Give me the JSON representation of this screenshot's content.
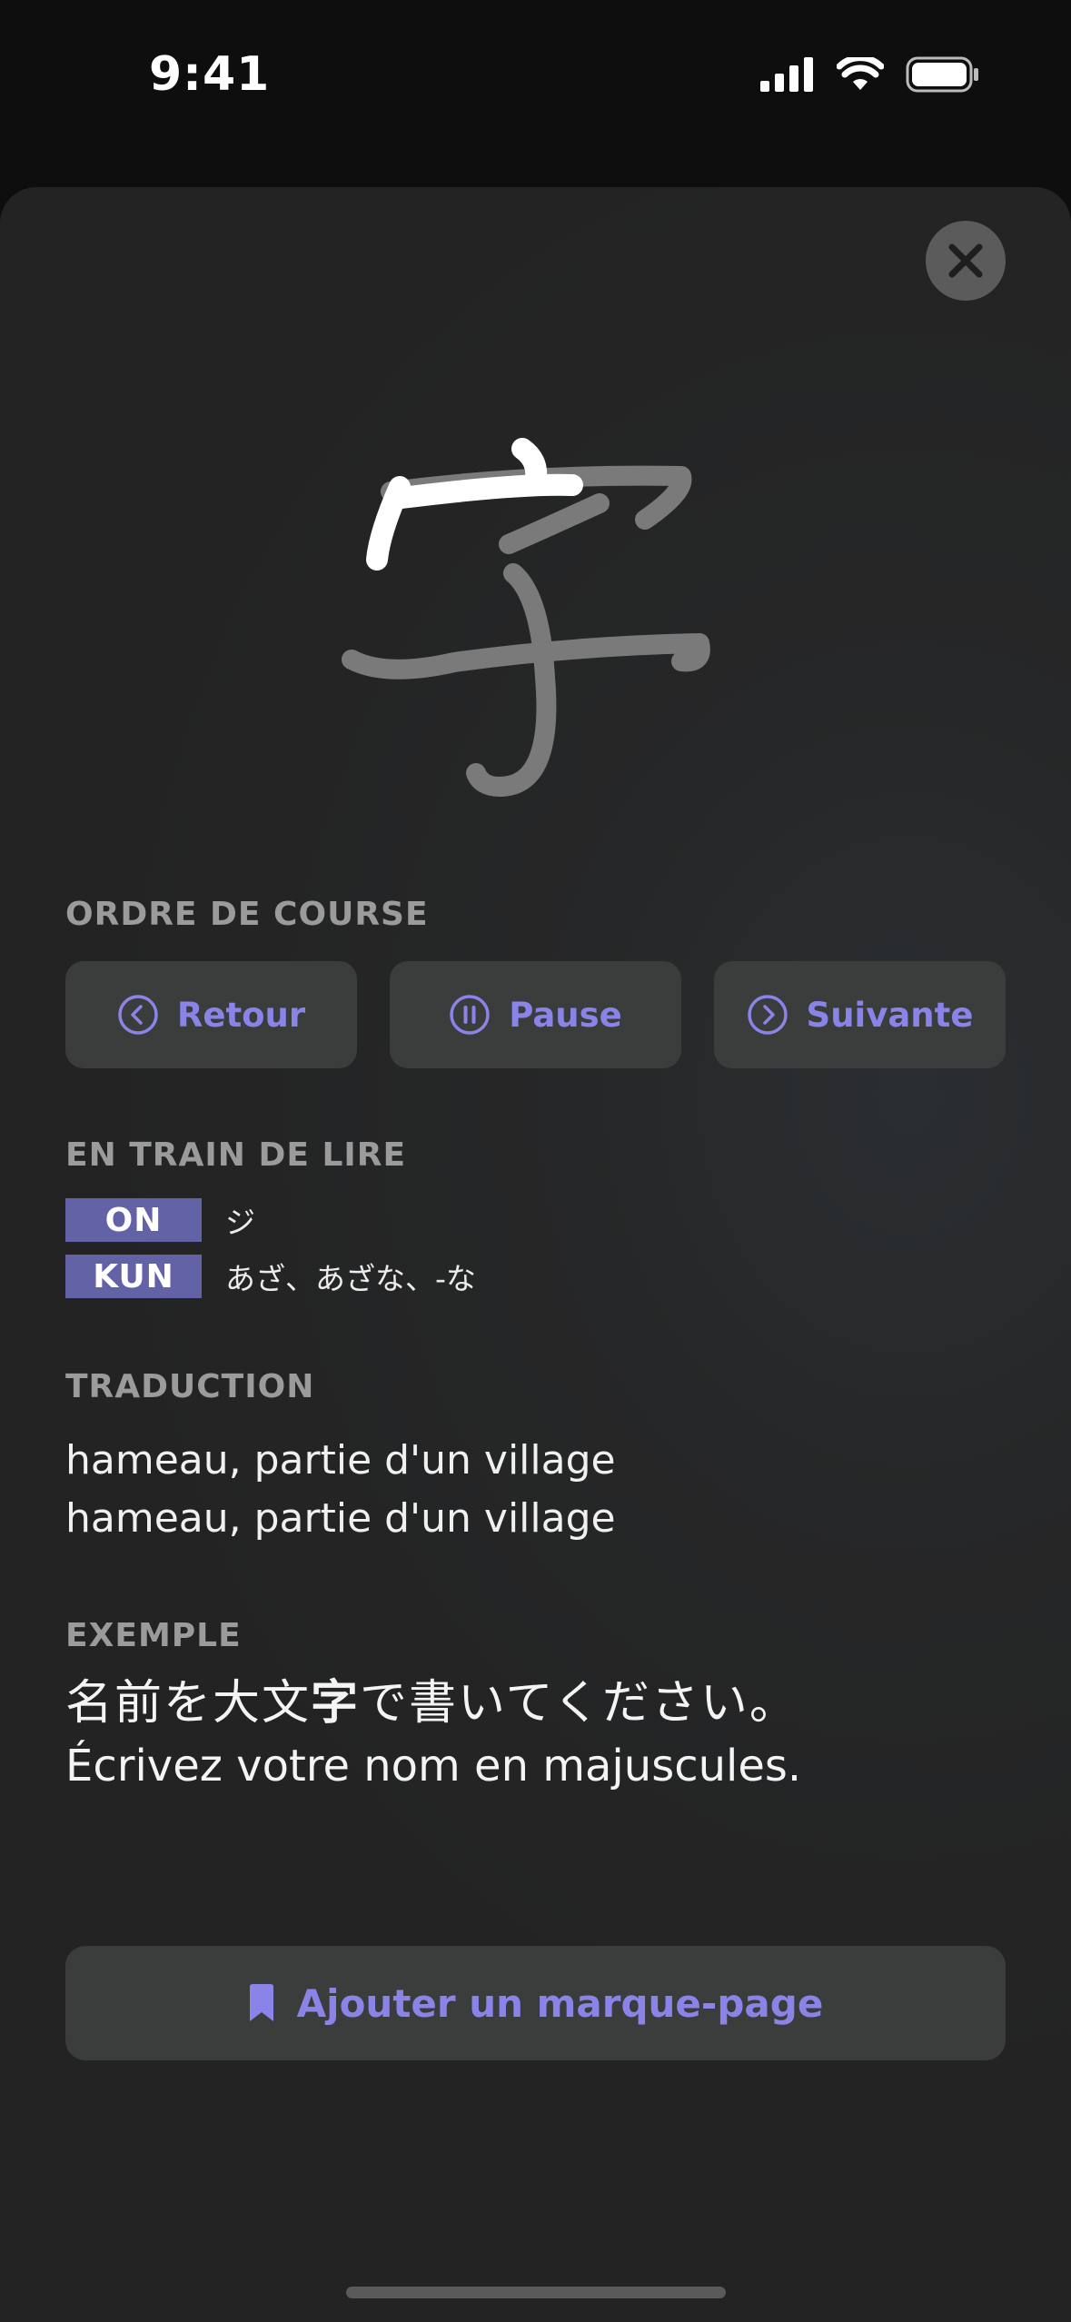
{
  "status_bar": {
    "time": "9:41"
  },
  "close": {
    "icon": "close-icon"
  },
  "kanji": {
    "character": "字"
  },
  "stroke_order": {
    "label": "ORDRE DE COURSE",
    "buttons": [
      {
        "label": "Retour",
        "icon": "chevron-left-circle-icon"
      },
      {
        "label": "Pause",
        "icon": "pause-circle-icon"
      },
      {
        "label": "Suivante",
        "icon": "chevron-right-circle-icon"
      }
    ]
  },
  "readings": {
    "label": "EN TRAIN DE LIRE",
    "items": [
      {
        "tag": "ON",
        "value": "ジ"
      },
      {
        "tag": "KUN",
        "value": "あざ、あざな、-な"
      }
    ]
  },
  "translation": {
    "label": "TRADUCTION",
    "lines": [
      "hameau, partie d'un village",
      "hameau, partie d'un village"
    ]
  },
  "example": {
    "label": "EXEMPLE",
    "jp_before": "名前を大文",
    "jp_highlight": "字",
    "jp_after": "で書いてください。",
    "fr": "Écrivez votre nom en majuscules."
  },
  "bookmark": {
    "label": "Ajouter un marque-page",
    "icon": "bookmark-icon"
  },
  "colors": {
    "accent": "#8b84e8",
    "tag": "#6462a7"
  }
}
